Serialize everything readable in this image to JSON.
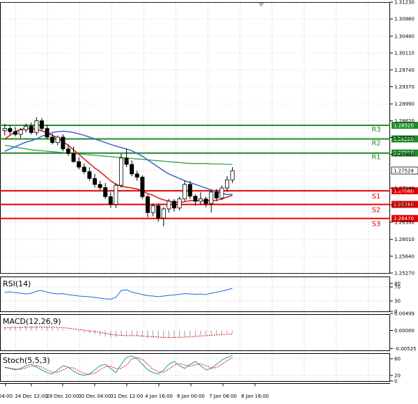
{
  "chart_data": {
    "type": "candlestick",
    "main": {
      "ylim": [
        1.2527,
        1.3123
      ],
      "y_ticks": [
        "1.31230",
        "1.30860",
        "1.30480",
        "1.30110",
        "1.29740",
        "1.29370",
        "1.28990",
        "1.28620",
        "1.28250",
        "1.27880",
        "1.27524",
        "1.27140",
        "1.26770",
        "1.26390",
        "1.26010",
        "1.25640",
        "1.25270"
      ],
      "current_price": "1.27524",
      "levels": [
        {
          "name": "R3",
          "value": 1.2852,
          "label": "1.28520",
          "color": "#1e8c28"
        },
        {
          "name": "R2",
          "value": 1.2822,
          "label": "1.28220",
          "color": "#1e8c28"
        },
        {
          "name": "R1",
          "value": 1.2791,
          "label": "1.27910",
          "color": "#1e8c28"
        },
        {
          "name": "S1",
          "value": 1.2708,
          "label": "1.27080",
          "color": "#e00000"
        },
        {
          "name": "S2",
          "value": 1.2678,
          "label": "1.26780",
          "color": "#e00000"
        },
        {
          "name": "S3",
          "value": 1.2647,
          "label": "1.26470",
          "color": "#e00000"
        }
      ],
      "candles": [
        [
          1.284,
          1.2855,
          1.283,
          1.2845
        ],
        [
          1.2845,
          1.2852,
          1.2832,
          1.2838
        ],
        [
          1.2838,
          1.2848,
          1.2828,
          1.2832
        ],
        [
          1.2832,
          1.2846,
          1.2824,
          1.2842
        ],
        [
          1.2842,
          1.2856,
          1.2836,
          1.285
        ],
        [
          1.285,
          1.2858,
          1.2832,
          1.2836
        ],
        [
          1.2836,
          1.287,
          1.283,
          1.2862
        ],
        [
          1.2862,
          1.2868,
          1.284,
          1.2845
        ],
        [
          1.2845,
          1.2852,
          1.2822,
          1.2826
        ],
        [
          1.2826,
          1.2834,
          1.281,
          1.2814
        ],
        [
          1.2814,
          1.283,
          1.2808,
          1.2826
        ],
        [
          1.2826,
          1.2832,
          1.2795,
          1.28
        ],
        [
          1.28,
          1.281,
          1.2785,
          1.279
        ],
        [
          1.279,
          1.2805,
          1.277,
          1.2772
        ],
        [
          1.2772,
          1.2782,
          1.2755,
          1.276
        ],
        [
          1.276,
          1.2768,
          1.2745,
          1.275
        ],
        [
          1.275,
          1.276,
          1.273,
          1.2735
        ],
        [
          1.2735,
          1.2745,
          1.2715,
          1.2722
        ],
        [
          1.2722,
          1.273,
          1.271,
          1.2715
        ],
        [
          1.2715,
          1.2725,
          1.269,
          1.2695
        ],
        [
          1.2695,
          1.2705,
          1.267,
          1.2678
        ],
        [
          1.2678,
          1.2725,
          1.267,
          1.272
        ],
        [
          1.272,
          1.279,
          1.2715,
          1.278
        ],
        [
          1.278,
          1.28,
          1.276,
          1.2766
        ],
        [
          1.2766,
          1.2775,
          1.274,
          1.2745
        ],
        [
          1.2745,
          1.2752,
          1.273,
          1.2738
        ],
        [
          1.2738,
          1.2742,
          1.269,
          1.2695
        ],
        [
          1.2695,
          1.27,
          1.265,
          1.266
        ],
        [
          1.266,
          1.268,
          1.2652,
          1.2675
        ],
        [
          1.2675,
          1.268,
          1.264,
          1.2648
        ],
        [
          1.2648,
          1.2672,
          1.263,
          1.2668
        ],
        [
          1.2668,
          1.269,
          1.266,
          1.2685
        ],
        [
          1.2685,
          1.269,
          1.2662,
          1.267
        ],
        [
          1.267,
          1.2695,
          1.2665,
          1.269
        ],
        [
          1.269,
          1.273,
          1.2685,
          1.2722
        ],
        [
          1.2722,
          1.273,
          1.269,
          1.2696
        ],
        [
          1.2696,
          1.27,
          1.2675,
          1.2685
        ],
        [
          1.2685,
          1.2705,
          1.2678,
          1.269
        ],
        [
          1.269,
          1.2695,
          1.2672,
          1.268
        ],
        [
          1.268,
          1.271,
          1.266,
          1.2705
        ],
        [
          1.2705,
          1.2712,
          1.2685,
          1.2692
        ],
        [
          1.2692,
          1.272,
          1.2688,
          1.2714
        ],
        [
          1.2714,
          1.274,
          1.2706,
          1.2732
        ],
        [
          1.2732,
          1.276,
          1.2725,
          1.2752
        ]
      ],
      "ma_blue": [
        1.2795,
        1.28,
        1.2805,
        1.281,
        1.2815,
        1.2818,
        1.2822,
        1.2828,
        1.2832,
        1.2836,
        1.2838,
        1.2839,
        1.2838,
        1.2836,
        1.2833,
        1.283,
        1.2826,
        1.2822,
        1.2818,
        1.2814,
        1.281,
        1.2806,
        1.2803,
        1.28,
        1.2796,
        1.279,
        1.2784,
        1.2776,
        1.2768,
        1.276,
        1.2752,
        1.2745,
        1.274,
        1.2735,
        1.273,
        1.2726,
        1.2722,
        1.2718,
        1.2714,
        1.271,
        1.2706,
        1.2702,
        1.27,
        1.27
      ],
      "ma_red": [
        1.2822,
        1.283,
        1.2838,
        1.2843,
        1.2845,
        1.2845,
        1.2843,
        1.284,
        1.2835,
        1.283,
        1.2824,
        1.2816,
        1.2808,
        1.2798,
        1.2788,
        1.2778,
        1.2768,
        1.2758,
        1.275,
        1.274,
        1.273,
        1.2722,
        1.2718,
        1.2716,
        1.2714,
        1.2712,
        1.2708,
        1.2702,
        1.2698,
        1.2692,
        1.2688,
        1.2685,
        1.2683,
        1.2682,
        1.2684,
        1.2686,
        1.2686,
        1.2686,
        1.2686,
        1.2686,
        1.2687,
        1.269,
        1.2694,
        1.2698
      ],
      "ma_green": [
        1.2808,
        1.2806,
        1.2804,
        1.2802,
        1.28,
        1.2798,
        1.2797,
        1.2796,
        1.2795,
        1.2794,
        1.2793,
        1.2792,
        1.2791,
        1.279,
        1.2789,
        1.2788,
        1.2787,
        1.2786,
        1.2785,
        1.2784,
        1.2783,
        1.2782,
        1.2781,
        1.278,
        1.2779,
        1.2778,
        1.2777,
        1.2776,
        1.2775,
        1.2774,
        1.2773,
        1.2772,
        1.2771,
        1.277,
        1.2769,
        1.2768,
        1.2768,
        1.2768,
        1.2768,
        1.2767,
        1.2767,
        1.2767,
        1.2766,
        1.2766
      ]
    },
    "x_ticks": [
      "04:00",
      "24 Dec 12:00",
      "28 Dec 20:00",
      "30 Dec 04:00",
      "31 Dec 12:00",
      "4 Jan 16:00",
      "6 Jan 00:00",
      "7 Jan 08:00",
      "8 Jan 16:00"
    ],
    "rsi": {
      "label": "RSI(14)",
      "ylim": [
        0,
        100
      ],
      "y_ticks": [
        "80",
        "70",
        "30",
        "0"
      ],
      "values": [
        55,
        56,
        54,
        52,
        50,
        52,
        58,
        60,
        55,
        52,
        50,
        51,
        48,
        46,
        44,
        43,
        42,
        40,
        38,
        36,
        35,
        40,
        60,
        62,
        55,
        52,
        48,
        45,
        44,
        42,
        44,
        46,
        47,
        49,
        51,
        50,
        49,
        50,
        48,
        52,
        55,
        58,
        62,
        66
      ],
      "color": "#1e64dc"
    },
    "macd": {
      "label": "MACD(12,26,9)",
      "ylim": [
        -0.0058,
        0.0048
      ],
      "y_ticks": [
        "0.00499",
        "0.00000",
        "-0.00525"
      ],
      "hist": [
        0.001,
        0.0011,
        0.0011,
        0.0012,
        0.0012,
        0.0012,
        0.0013,
        0.0012,
        0.001,
        0.0008,
        0.0006,
        0.0004,
        0.0002,
        0.0,
        -0.0003,
        -0.0006,
        -0.0009,
        -0.0012,
        -0.0015,
        -0.0018,
        -0.002,
        -0.0019,
        -0.0016,
        -0.0015,
        -0.0015,
        -0.0016,
        -0.0018,
        -0.0021,
        -0.0022,
        -0.0023,
        -0.0022,
        -0.0021,
        -0.002,
        -0.0019,
        -0.0017,
        -0.0016,
        -0.0015,
        -0.0014,
        -0.0013,
        -0.0012,
        -0.0011,
        -0.001,
        -0.0008,
        -0.0006
      ],
      "signal": [
        0.0008,
        0.0008,
        0.0009,
        0.0009,
        0.001,
        0.001,
        0.001,
        0.001,
        0.001,
        0.001,
        0.0009,
        0.0008,
        0.0007,
        0.0005,
        0.0003,
        0.0001,
        -0.0001,
        -0.0003,
        -0.0006,
        -0.0008,
        -0.0011,
        -0.0013,
        -0.0014,
        -0.0015,
        -0.0015,
        -0.0015,
        -0.0016,
        -0.0017,
        -0.0018,
        -0.0019,
        -0.002,
        -0.002,
        -0.002,
        -0.002,
        -0.0019,
        -0.0018,
        -0.0017,
        -0.0016,
        -0.0015,
        -0.0014,
        -0.0013,
        -0.0012,
        -0.0011,
        -0.001
      ],
      "hist_color": "#a0a0a0",
      "signal_color": "#e00000"
    },
    "stoch": {
      "label": "Stoch(5,5,3)",
      "ylim": [
        0,
        100
      ],
      "y_ticks": [
        "80",
        "20",
        "0"
      ],
      "k": [
        50,
        45,
        40,
        45,
        55,
        60,
        50,
        40,
        30,
        25,
        40,
        55,
        50,
        35,
        25,
        20,
        25,
        40,
        55,
        60,
        45,
        30,
        60,
        85,
        90,
        80,
        60,
        40,
        30,
        25,
        40,
        60,
        70,
        55,
        45,
        60,
        70,
        55,
        40,
        45,
        60,
        75,
        85,
        92
      ],
      "d": [
        48,
        46,
        43,
        42,
        47,
        53,
        55,
        50,
        40,
        32,
        32,
        40,
        48,
        47,
        37,
        27,
        24,
        28,
        40,
        52,
        53,
        45,
        45,
        58,
        78,
        85,
        77,
        60,
        43,
        32,
        32,
        42,
        57,
        62,
        57,
        53,
        58,
        62,
        55,
        47,
        48,
        60,
        73,
        84
      ],
      "k_color": "#1ea0a0",
      "d_color": "#e00000"
    }
  }
}
